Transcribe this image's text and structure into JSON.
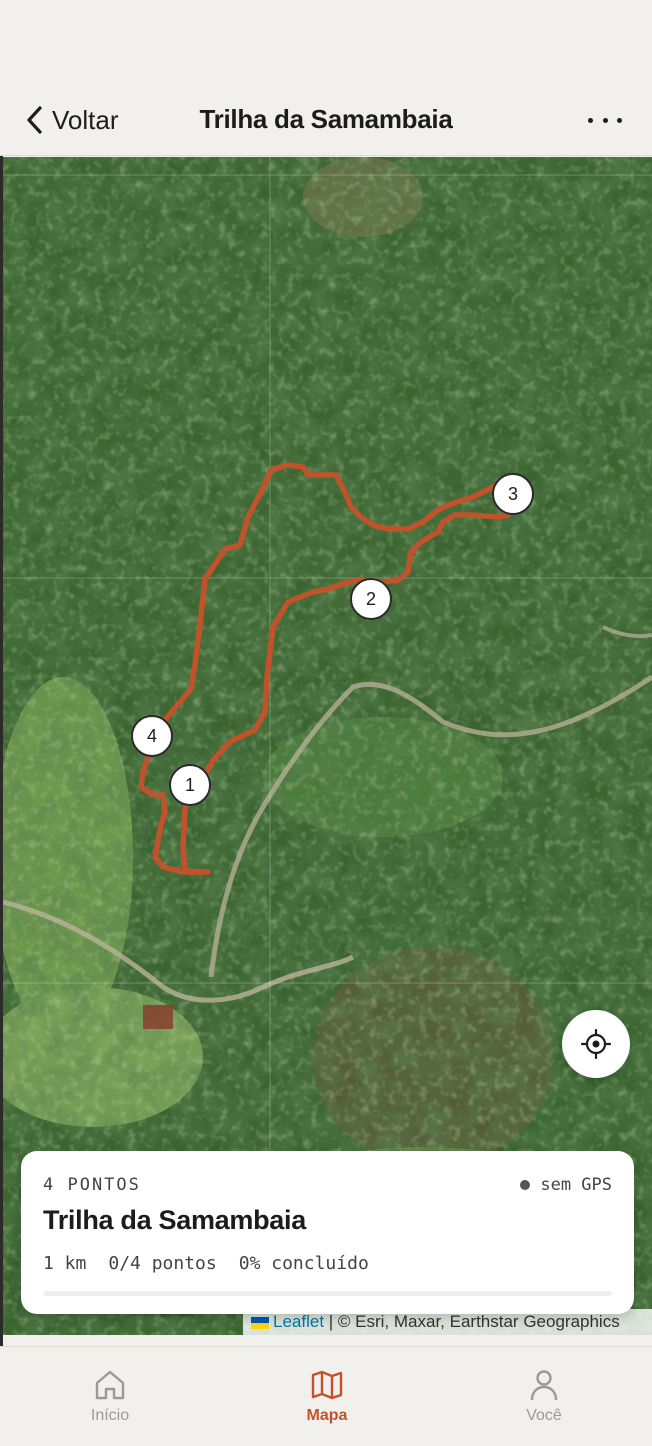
{
  "nav": {
    "back_label": "Voltar",
    "title": "Trilha da Samambaia"
  },
  "map": {
    "waypoints": [
      {
        "number": "1"
      },
      {
        "number": "2"
      },
      {
        "number": "3"
      },
      {
        "number": "4"
      }
    ],
    "route_color": "#c0532b",
    "attribution": {
      "leaflet_link": "Leaflet",
      "rest": " | © Esri, Maxar, Earthstar Geographics"
    }
  },
  "card": {
    "count_label": "4 PONTOS",
    "gps_label": "sem GPS",
    "title": "Trilha da Samambaia",
    "distance": "1 km",
    "points_progress": "0/4 pontos",
    "completion": "0% concluído",
    "progress_fraction": 0
  },
  "tabs": [
    {
      "label": "Início",
      "icon": "home-icon",
      "active": false
    },
    {
      "label": "Mapa",
      "icon": "map-icon",
      "active": true
    },
    {
      "label": "Você",
      "icon": "person-icon",
      "active": false
    }
  ],
  "colors": {
    "accent": "#c0532b",
    "background": "#f1f0ec"
  }
}
